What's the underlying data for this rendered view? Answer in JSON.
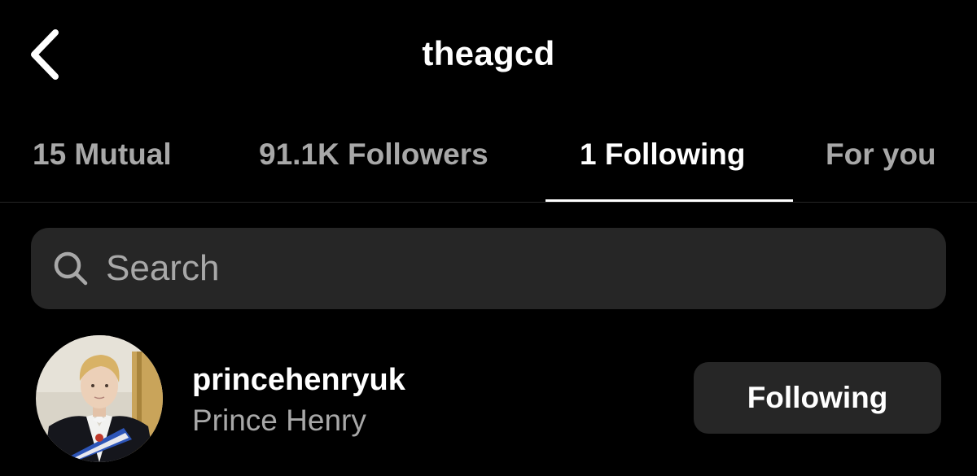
{
  "header": {
    "title": "theagcd",
    "back_icon": "chevron-left-icon"
  },
  "tabs": [
    {
      "label": "15 Mutual",
      "active": false
    },
    {
      "label": "91.1K Followers",
      "active": false
    },
    {
      "label": "1 Following",
      "active": true
    },
    {
      "label": "For you",
      "active": false
    }
  ],
  "search": {
    "placeholder": "Search",
    "value": "",
    "icon": "search-icon"
  },
  "following_list": [
    {
      "username": "princehenryuk",
      "full_name": "Prince Henry",
      "button_label": "Following"
    }
  ],
  "colors": {
    "background": "#000000",
    "text_primary": "#ffffff",
    "text_secondary": "#a8a8a8",
    "surface": "#262626"
  }
}
